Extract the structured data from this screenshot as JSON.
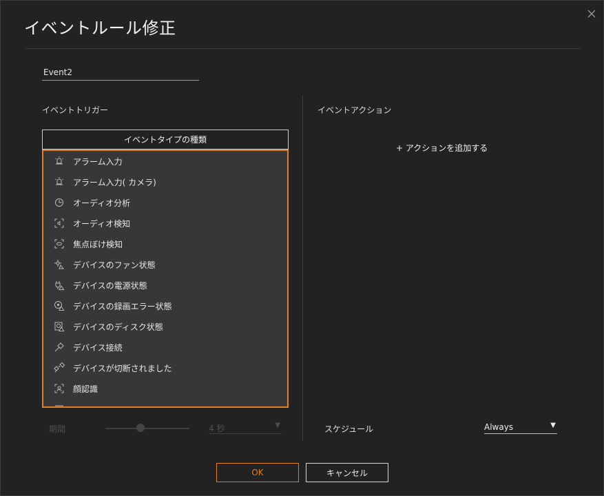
{
  "dialog": {
    "title": "イベントルール修正",
    "close_icon": "close-icon"
  },
  "rule_name": {
    "value": "Event2"
  },
  "trigger": {
    "section_label": "イベントトリガー",
    "type_header": "イベントタイプの種類",
    "items": [
      {
        "label": "アラーム入力",
        "icon": "alarm-input-icon"
      },
      {
        "label": "アラーム入力( カメラ)",
        "icon": "alarm-input-camera-icon"
      },
      {
        "label": "オーディオ分析",
        "icon": "audio-analysis-icon"
      },
      {
        "label": "オーディオ検知",
        "icon": "audio-detection-icon"
      },
      {
        "label": "焦点ぼけ検知",
        "icon": "defocus-detection-icon"
      },
      {
        "label": "デバイスのファン状態",
        "icon": "device-fan-status-icon"
      },
      {
        "label": "デバイスの電源状態",
        "icon": "device-power-status-icon"
      },
      {
        "label": "デバイスの録画エラー状態",
        "icon": "device-recording-error-icon"
      },
      {
        "label": "デバイスのディスク状態",
        "icon": "device-disk-status-icon"
      },
      {
        "label": "デバイス接続",
        "icon": "device-connect-icon"
      },
      {
        "label": "デバイスが切断されました",
        "icon": "device-disconnect-icon"
      },
      {
        "label": "顔認識",
        "icon": "face-recognition-icon"
      }
    ],
    "period_label": "期間",
    "period_value": "4 秒"
  },
  "action": {
    "section_label": "イベントアクション",
    "add_label": "+ アクションを追加する",
    "schedule_label": "スケジュール",
    "schedule_value": "Always"
  },
  "footer": {
    "ok_label": "OK",
    "cancel_label": "キャンセル"
  },
  "colors": {
    "accent": "#e57e1e",
    "background": "#222222",
    "list_background": "#373737"
  }
}
